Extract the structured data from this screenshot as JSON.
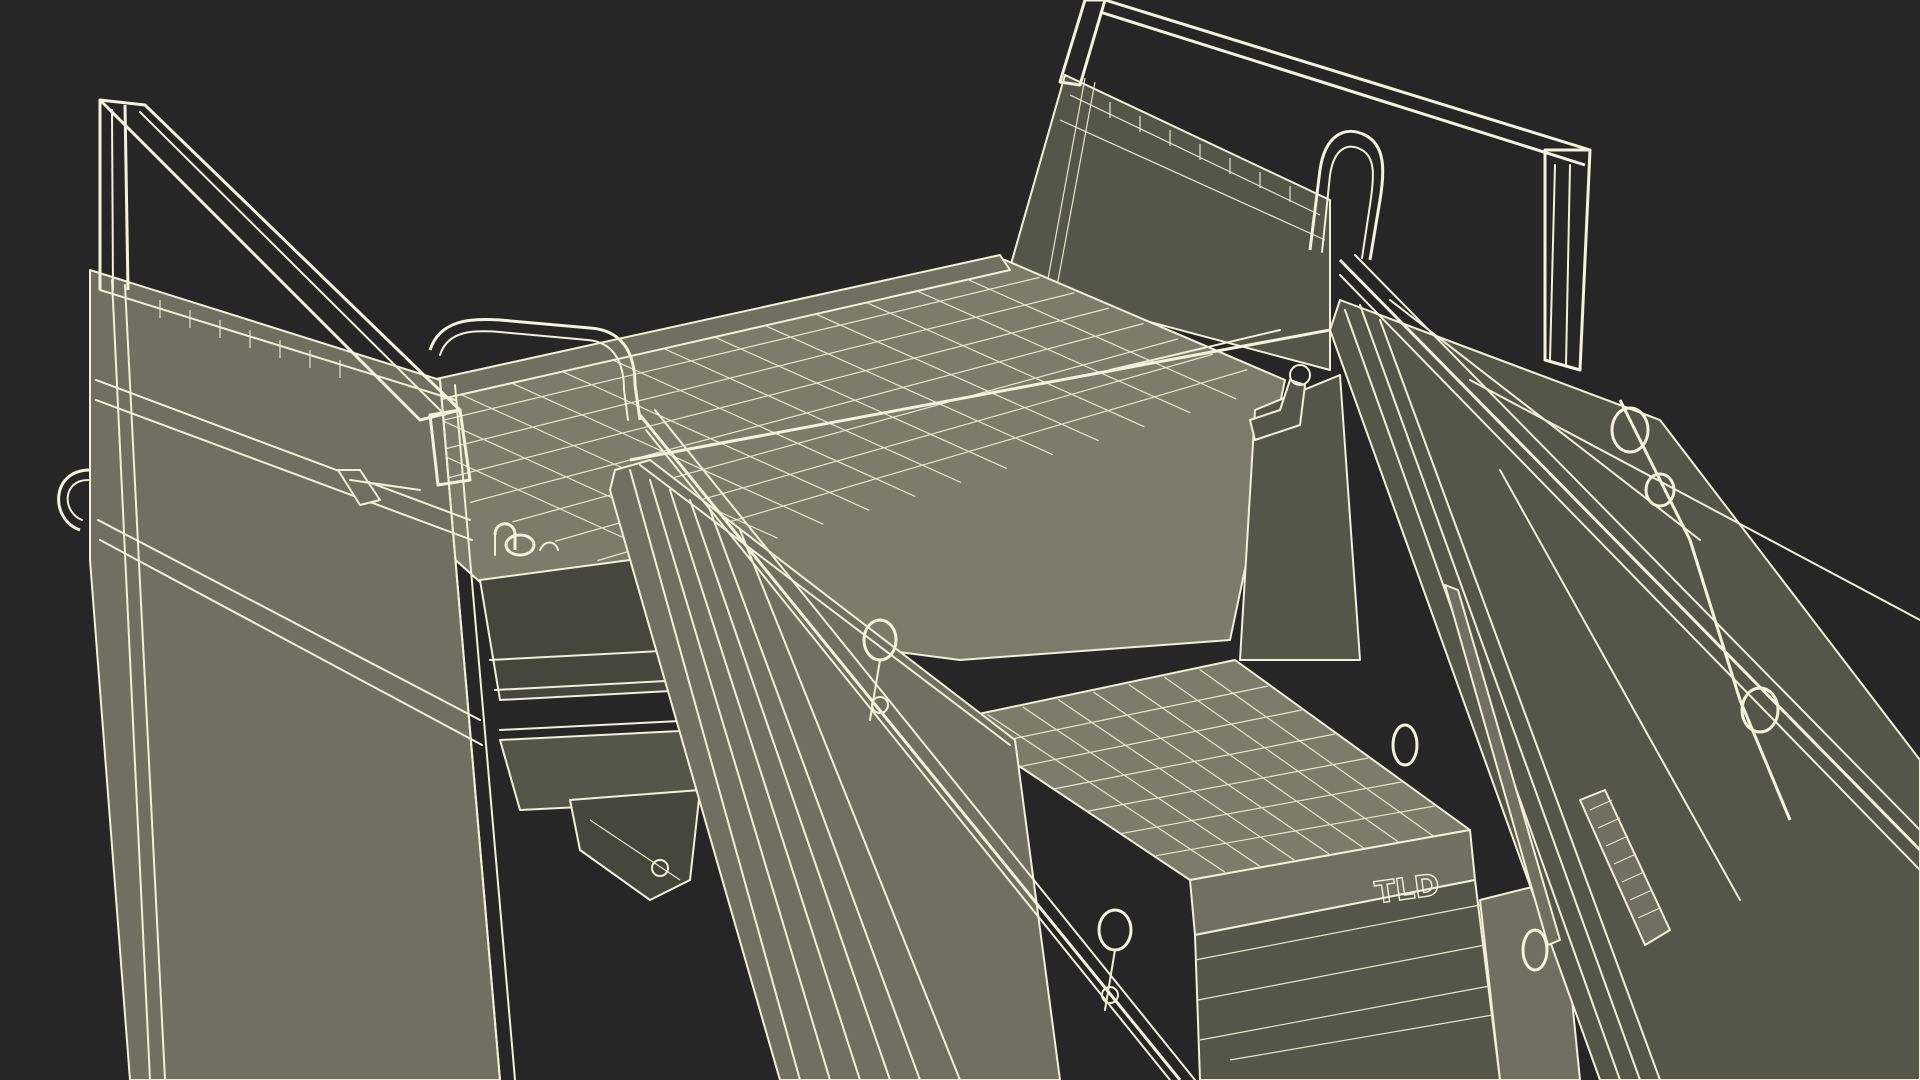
{
  "scene": {
    "platform_marking": "TLD"
  }
}
